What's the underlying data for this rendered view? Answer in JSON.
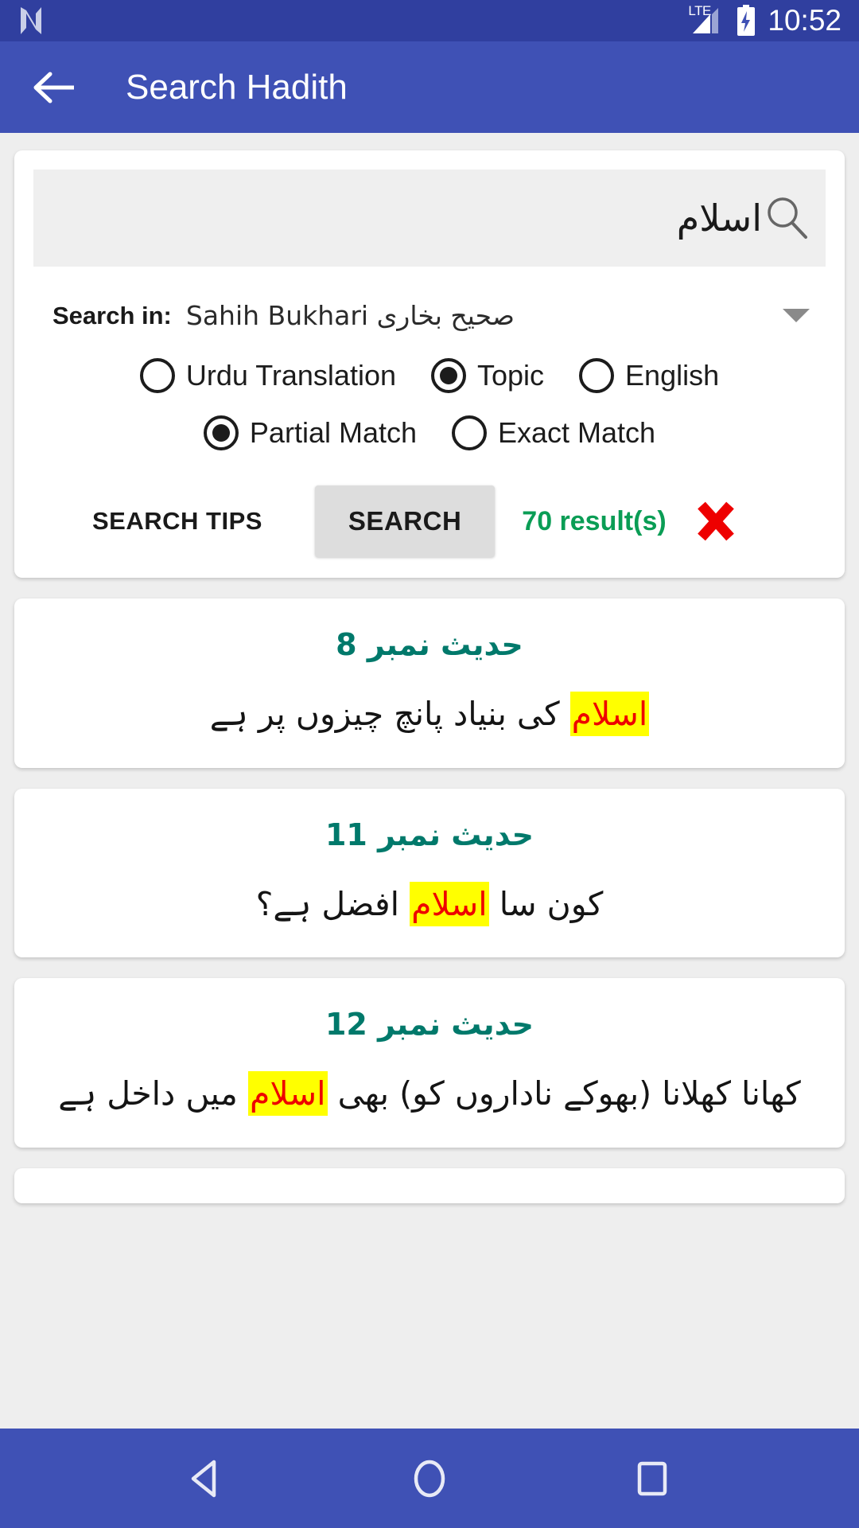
{
  "status_bar": {
    "network_label": "LTE",
    "time": "10:52",
    "notification_icon": "n-logo-icon",
    "signal_icon": "signal-bars-icon",
    "battery_icon": "battery-charging-icon"
  },
  "app_bar": {
    "back_icon": "back-arrow-icon",
    "title": "Search Hadith",
    "background_color": "#3f51b5"
  },
  "search_card": {
    "query": "اسلام",
    "query_placeholder": "",
    "search_icon": "magnifier-icon",
    "search_in_label": "Search in:",
    "search_in_value": "Sahih Bukhari صحیح بخاری",
    "dropdown_icon": "chevron-down-icon",
    "field_options": [
      {
        "label": "Urdu Translation",
        "selected": false
      },
      {
        "label": "Topic",
        "selected": true
      },
      {
        "label": "English",
        "selected": false
      }
    ],
    "match_options": [
      {
        "label": "Partial Match",
        "selected": true
      },
      {
        "label": "Exact Match",
        "selected": false
      }
    ],
    "search_tips_label": "SEARCH TIPS",
    "search_button_label": "SEARCH",
    "result_count_label": "70 result(s)",
    "result_count_color": "#0a9d55",
    "clear_icon": "red-cross-clear-icon"
  },
  "results": [
    {
      "number_label": "حدیث نمبر 8",
      "text_before": "کی بنیاد پانچ چیزوں پر ہے",
      "highlight": "اسلام",
      "text_after": ""
    },
    {
      "number_label": "حدیث نمبر 11",
      "text_before": "کون سا",
      "highlight": "اسلام",
      "text_after": "افضل ہے؟"
    },
    {
      "number_label": "حدیث نمبر 12",
      "text_before": "کھانا کھلانا (بھوکے ناداروں کو) بھی",
      "highlight": "اسلام",
      "text_after": "میں داخل ہے"
    }
  ],
  "nav_bar": {
    "back_icon": "nav-back-triangle-icon",
    "home_icon": "nav-home-circle-icon",
    "recents_icon": "nav-recents-square-icon",
    "background_color": "#3f51b5"
  }
}
